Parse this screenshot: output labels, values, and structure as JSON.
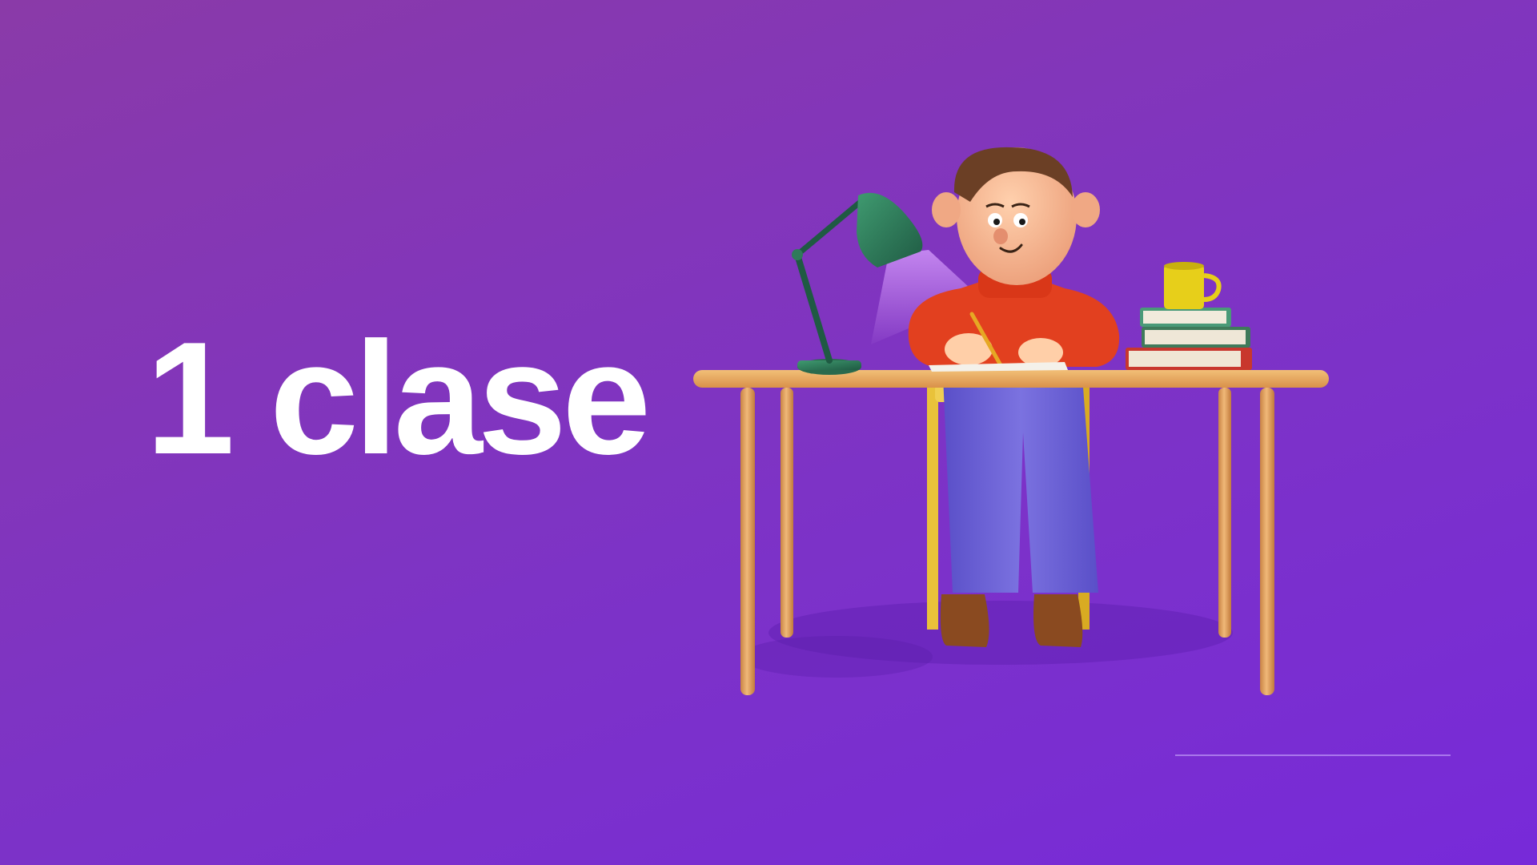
{
  "slide": {
    "headline": "1 clase"
  },
  "illustration": {
    "subject": "person-writing-at-desk",
    "objects": [
      "desk-lamp",
      "desk",
      "chair",
      "person",
      "book-stack",
      "mug",
      "pencil"
    ]
  },
  "colors": {
    "background_start": "#8a3aa8",
    "background_end": "#772ad9",
    "headline": "#ffffff",
    "sweater": "#e2401f",
    "trousers": "#6e63d6",
    "desk_wood": "#e8a95c",
    "lamp": "#2f7a5a",
    "mug": "#e7cf1a",
    "chair": "#e9c23a"
  }
}
